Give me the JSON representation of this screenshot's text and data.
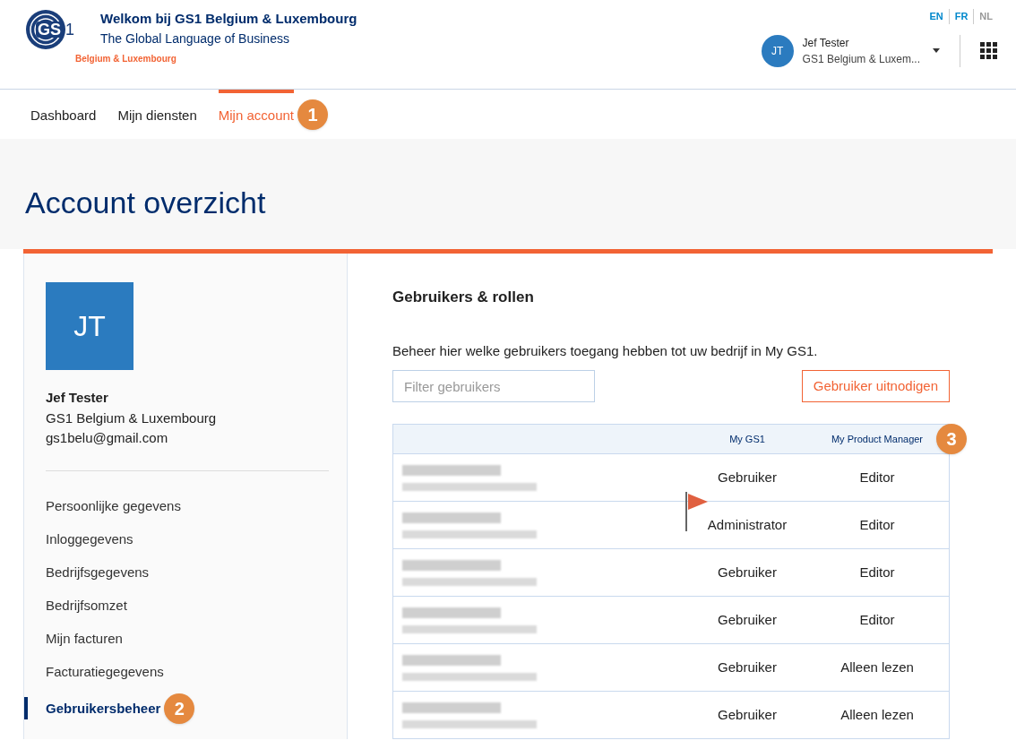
{
  "header": {
    "welcome": "Welkom bij GS1 Belgium & Luxembourg",
    "tagline": "The Global Language of Business",
    "logo_text": "GS1",
    "logo_subtitle": "Belgium & Luxembourg",
    "languages": [
      {
        "label": "EN",
        "selected": false
      },
      {
        "label": "FR",
        "selected": false
      },
      {
        "label": "NL",
        "selected": true
      }
    ],
    "user": {
      "initials": "JT",
      "name": "Jef Tester",
      "company": "GS1 Belgium & Luxem..."
    }
  },
  "nav": [
    {
      "label": "Dashboard",
      "selected": false
    },
    {
      "label": "Mijn diensten",
      "selected": false
    },
    {
      "label": "Mijn account",
      "selected": true,
      "callout": "1"
    }
  ],
  "page_title": "Account overzicht",
  "profile": {
    "initials": "JT",
    "name": "Jef Tester",
    "company": "GS1 Belgium & Luxembourg",
    "email": "gs1belu@gmail.com"
  },
  "sidebar": {
    "items": [
      {
        "label": "Persoonlijke gegevens",
        "selected": false
      },
      {
        "label": "Inloggegevens",
        "selected": false
      },
      {
        "label": "Bedrijfsgegevens",
        "selected": false
      },
      {
        "label": "Bedrijfsomzet",
        "selected": false
      },
      {
        "label": "Mijn facturen",
        "selected": false
      },
      {
        "label": "Facturatiegegevens",
        "selected": false
      },
      {
        "label": "Gebruikersbeheer",
        "selected": true,
        "callout": "2"
      }
    ]
  },
  "section": {
    "title": "Gebruikers & rollen",
    "description": "Beheer hier welke gebruikers toegang hebben tot uw bedrijf in My GS1.",
    "filter_placeholder": "Filter gebruikers",
    "invite_button": "Gebruiker uitnodigen"
  },
  "table": {
    "columns": [
      {
        "label": "My GS1"
      },
      {
        "label": "My Product Manager",
        "callout": "3"
      }
    ],
    "rows": [
      {
        "flagged": false,
        "cells": [
          "Gebruiker",
          "Editor"
        ]
      },
      {
        "flagged": true,
        "cells": [
          "Administrator",
          "Editor"
        ]
      },
      {
        "flagged": false,
        "cells": [
          "Gebruiker",
          "Editor"
        ]
      },
      {
        "flagged": false,
        "cells": [
          "Gebruiker",
          "Editor"
        ]
      },
      {
        "flagged": false,
        "cells": [
          "Gebruiker",
          "Alleen lezen"
        ]
      },
      {
        "flagged": false,
        "cells": [
          "Gebruiker",
          "Alleen lezen"
        ]
      }
    ]
  }
}
